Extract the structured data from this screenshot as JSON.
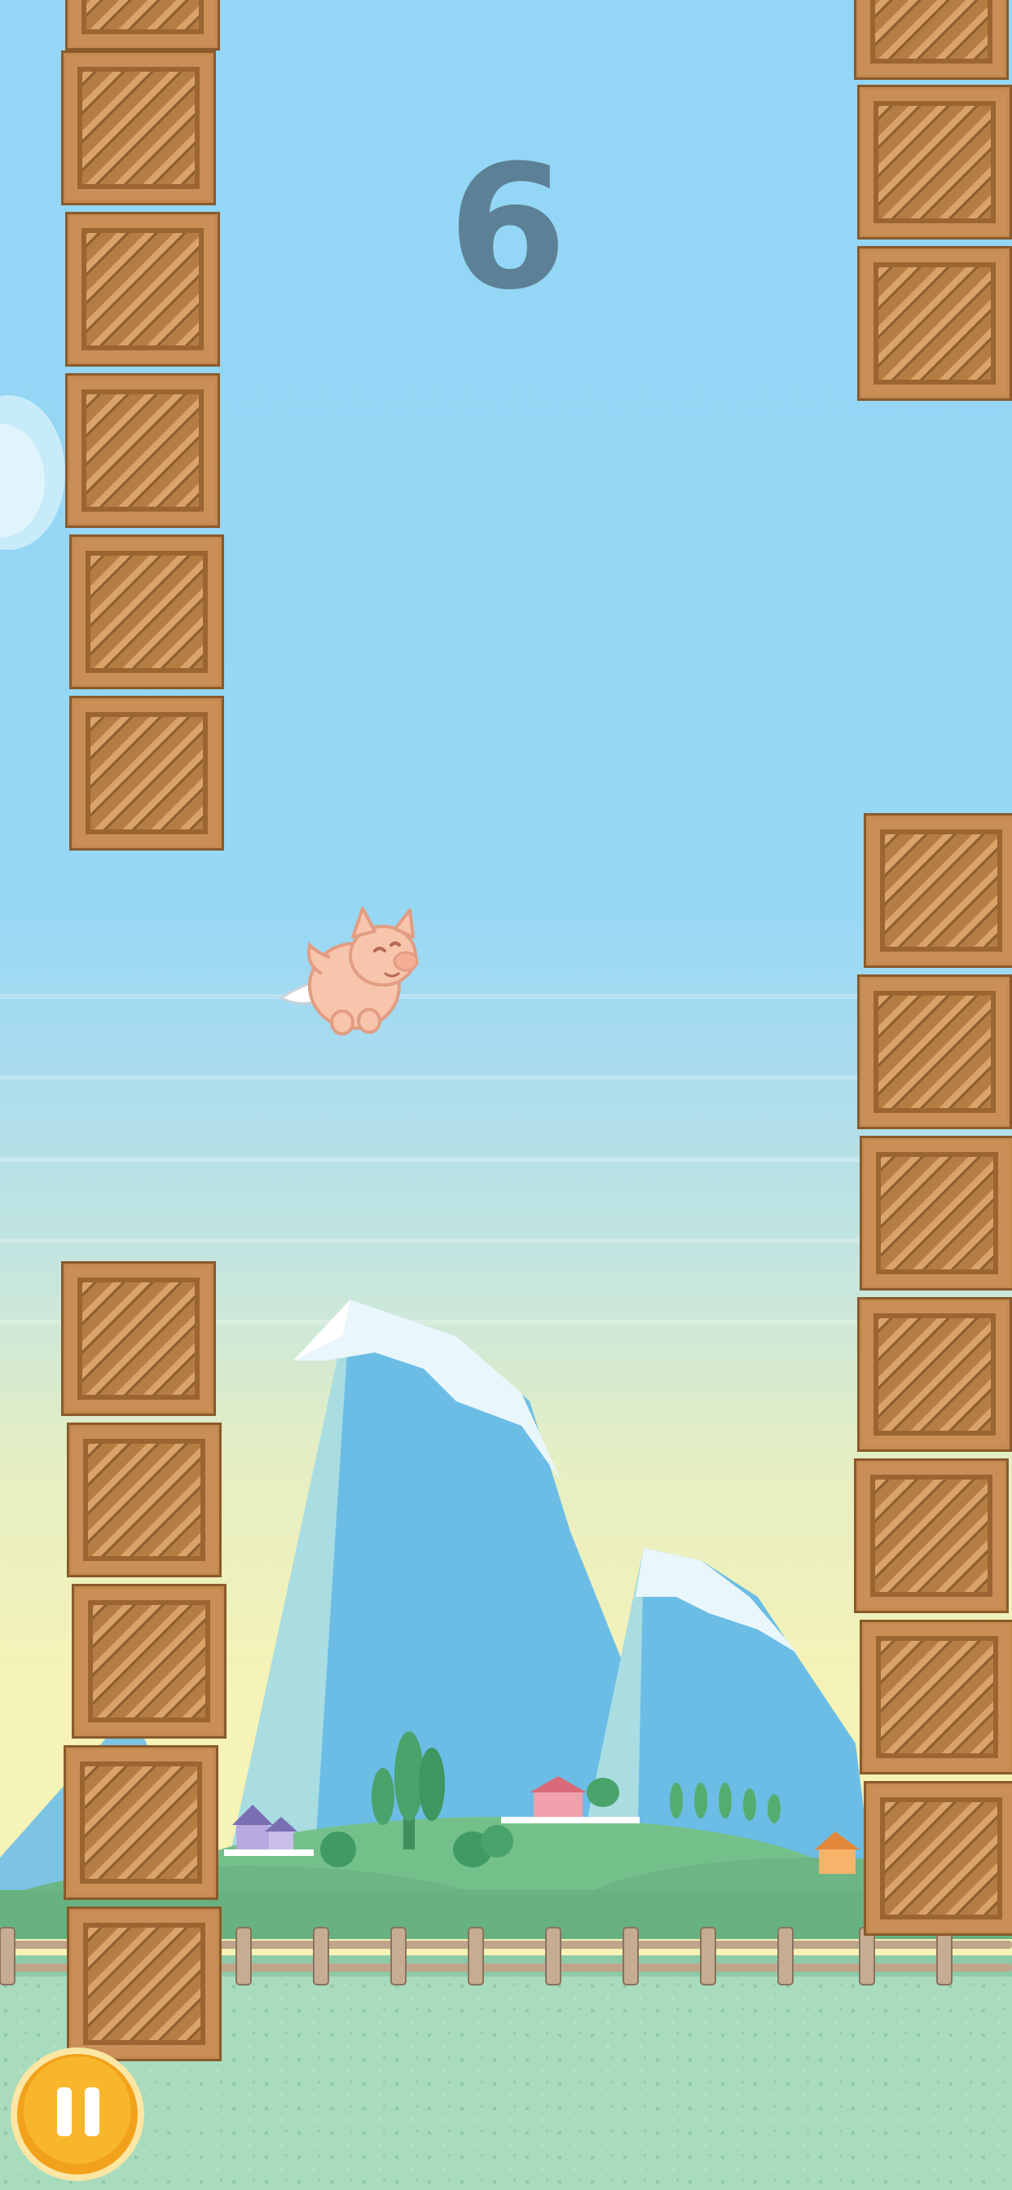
{
  "hud": {
    "score": "6",
    "pause_icon": "pause-icon"
  },
  "scene": {
    "player_icon": "flying-pig",
    "obstacle_icon": "wooden-crate",
    "crate_stacks": [
      {
        "name": "top-left",
        "crates": 6
      },
      {
        "name": "top-right",
        "crates": 3
      },
      {
        "name": "bottom-left",
        "crates": 5
      },
      {
        "name": "bottom-right",
        "crates": 7
      }
    ]
  },
  "colors": {
    "score": "#5c8095",
    "crate": "#b07a44",
    "pause_button": "#f5a51c",
    "sky": "#93d6f5"
  }
}
